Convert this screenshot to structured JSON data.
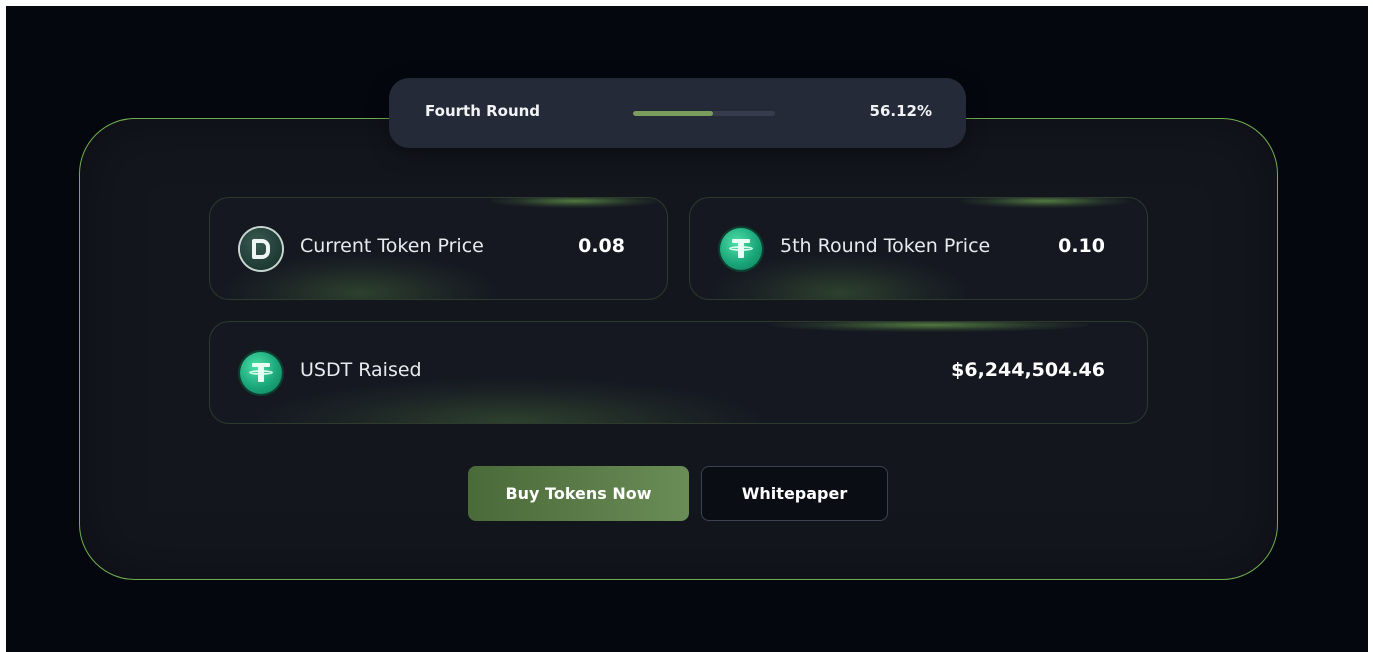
{
  "round": {
    "label": "Fourth Round",
    "progress_percent": 56.12,
    "progress_text": "56.12%"
  },
  "cards": {
    "current_price": {
      "label": "Current Token Price",
      "value": "0.08",
      "icon": "dash-coin-icon"
    },
    "next_round_price": {
      "label": "5th Round Token Price",
      "value": "0.10",
      "icon": "usdt-coin-icon"
    },
    "raised": {
      "label": "USDT Raised",
      "value": "$6,244,504.46",
      "icon": "usdt-coin-icon"
    }
  },
  "actions": {
    "buy_label": "Buy Tokens Now",
    "whitepaper_label": "Whitepaper"
  },
  "colors": {
    "accent": "#6fae4e",
    "background": "#05070f",
    "panel": "#14161e",
    "progress_fill": "#7a9c5c"
  }
}
